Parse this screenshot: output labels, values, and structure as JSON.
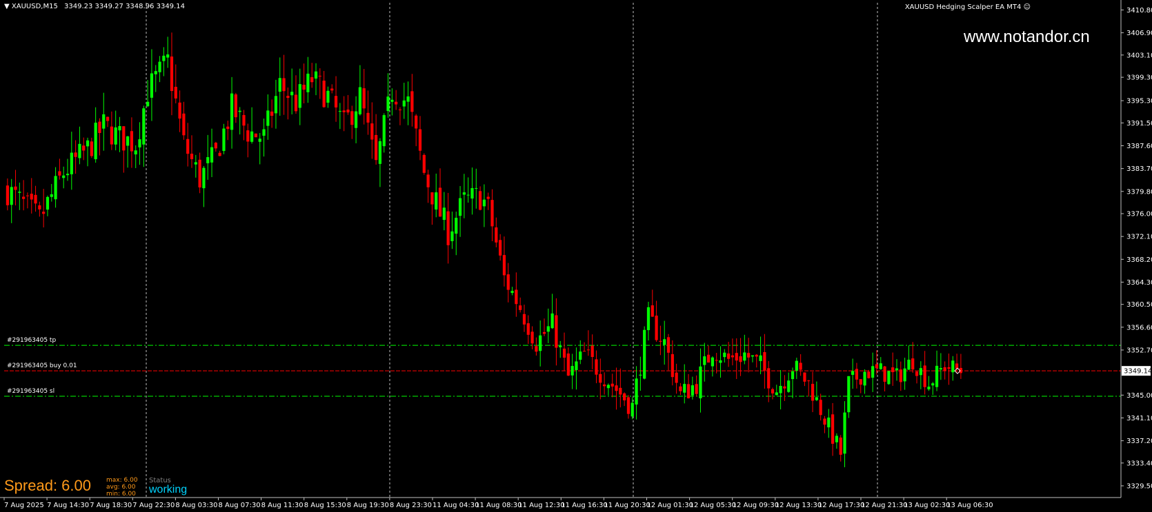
{
  "header": {
    "symbol_tf": "XAUUSD,M15",
    "ohlc": "3349.23 3349.27 3348.96 3349.14",
    "ea_name": "XAUUSD Hedging Scalper EA MT4",
    "watermark": "www.notandor.cn"
  },
  "panel": {
    "spread_label": "Spread: 6.00",
    "max": "max: 6.00",
    "avg": "avg: 6.00",
    "min": "min: 6.00",
    "status_label": "Status",
    "status_value": "working"
  },
  "orders": [
    {
      "label": "#291963405 tp",
      "price": 3353.5,
      "color": "#00ff00"
    },
    {
      "label": "#291963405 buy 0.01",
      "price": 3349.14,
      "color": "#ff0000"
    },
    {
      "label": "#291963405 sl",
      "price": 3344.8,
      "color": "#00ff00"
    }
  ],
  "colors": {
    "background": "#000000",
    "bull": "#00ff00",
    "bear": "#ff0000",
    "grid": "#c0c0c0",
    "price_line": "#ff0000",
    "spread_text": "#ff9a1a",
    "status_text": "#00d4ff"
  },
  "chart_data": {
    "type": "candlestick",
    "title": "",
    "xlabel": "",
    "ylabel": "",
    "ylim": [
      3327.5,
      3412.5
    ],
    "y_ticks": [
      "3410.80",
      "3406.90",
      "3403.10",
      "3399.30",
      "3395.30",
      "3391.50",
      "3387.60",
      "3383.70",
      "3379.80",
      "3376.00",
      "3372.10",
      "3368.20",
      "3364.30",
      "3360.50",
      "3356.60",
      "3352.70",
      "3345.00",
      "3341.10",
      "3337.20",
      "3333.40",
      "3329.50"
    ],
    "current_price": "3349.14",
    "x_ticks": [
      "7 Aug 2025",
      "7 Aug 14:30",
      "7 Aug 18:30",
      "7 Aug 22:30",
      "8 Aug 03:30",
      "8 Aug 07:30",
      "8 Aug 11:30",
      "8 Aug 15:30",
      "8 Aug 19:30",
      "8 Aug 23:30",
      "11 Aug 04:30",
      "11 Aug 08:30",
      "11 Aug 12:30",
      "11 Aug 16:30",
      "11 Aug 20:30",
      "12 Aug 01:30",
      "12 Aug 05:30",
      "12 Aug 09:30",
      "12 Aug 13:30",
      "12 Aug 17:30",
      "12 Aug 21:30",
      "13 Aug 02:30",
      "13 Aug 06:30"
    ],
    "day_separators": [
      "8 Aug 2025",
      "11 Aug 2025",
      "12 Aug 2025",
      "13 Aug 2025"
    ],
    "close_path": [
      [
        0,
        3380
      ],
      [
        8,
        3375
      ],
      [
        14,
        3383
      ],
      [
        20,
        3387
      ],
      [
        24,
        3391
      ],
      [
        28,
        3389
      ],
      [
        32,
        3388
      ],
      [
        35,
        3397
      ],
      [
        40,
        3402
      ],
      [
        44,
        3388
      ],
      [
        48,
        3382
      ],
      [
        52,
        3386
      ],
      [
        56,
        3394
      ],
      [
        60,
        3390
      ],
      [
        64,
        3389
      ],
      [
        68,
        3398
      ],
      [
        72,
        3395
      ],
      [
        76,
        3399
      ],
      [
        80,
        3396
      ],
      [
        84,
        3391
      ],
      [
        88,
        3396
      ],
      [
        92,
        3384
      ],
      [
        96,
        3397
      ],
      [
        100,
        3395
      ],
      [
        104,
        3383
      ],
      [
        108,
        3376
      ],
      [
        110,
        3373
      ],
      [
        114,
        3378
      ],
      [
        118,
        3379
      ],
      [
        120,
        3377
      ],
      [
        124,
        3365
      ],
      [
        128,
        3360
      ],
      [
        132,
        3354
      ],
      [
        136,
        3357
      ],
      [
        140,
        3348
      ],
      [
        144,
        3352
      ],
      [
        148,
        3349
      ],
      [
        152,
        3346
      ],
      [
        156,
        3343
      ],
      [
        160,
        3358
      ],
      [
        164,
        3354
      ],
      [
        168,
        3345
      ],
      [
        172,
        3347
      ],
      [
        176,
        3353
      ],
      [
        180,
        3351
      ],
      [
        184,
        3352
      ],
      [
        188,
        3350
      ],
      [
        192,
        3346
      ],
      [
        196,
        3350
      ],
      [
        200,
        3347
      ],
      [
        204,
        3341
      ],
      [
        208,
        3335
      ],
      [
        210,
        3347
      ],
      [
        214,
        3349
      ],
      [
        218,
        3349
      ],
      [
        222,
        3348
      ],
      [
        226,
        3351
      ],
      [
        230,
        3347
      ],
      [
        234,
        3350
      ],
      [
        238,
        3349.14
      ]
    ]
  }
}
